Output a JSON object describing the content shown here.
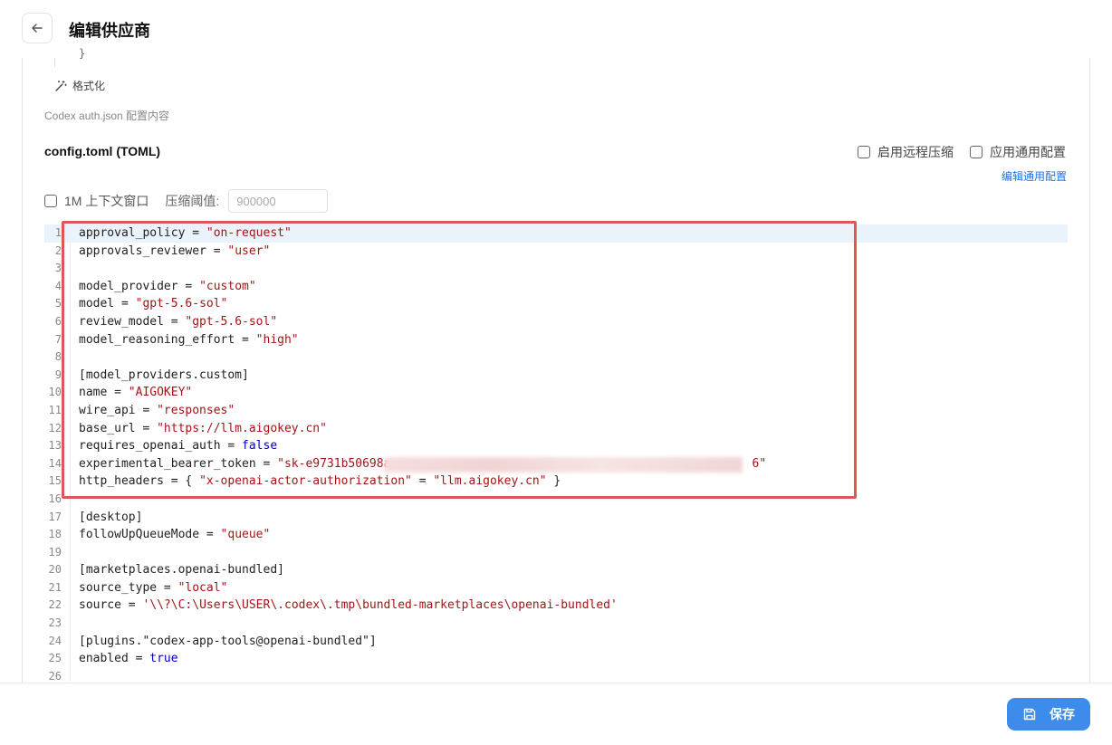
{
  "header": {
    "title": "编辑供应商"
  },
  "auth_section": {
    "json_tail": "}",
    "format_label": "格式化",
    "hint": "Codex auth.json 配置内容"
  },
  "config_section": {
    "title": "config.toml (TOML)",
    "remote_compress_label": "启用远程压缩",
    "apply_common_label": "应用通用配置",
    "edit_common_link": "编辑通用配置",
    "context_window_label": "1M 上下文窗口",
    "threshold_label": "压缩阈值:",
    "threshold_placeholder": "900000"
  },
  "editor": {
    "lines": [
      {
        "n": "1",
        "t": [
          {
            "c": "approval_policy = "
          },
          {
            "s": "\"on-request\""
          }
        ]
      },
      {
        "n": "2",
        "t": [
          {
            "c": "approvals_reviewer = "
          },
          {
            "s": "\"user\""
          }
        ]
      },
      {
        "n": "3",
        "t": []
      },
      {
        "n": "4",
        "t": [
          {
            "c": "model_provider = "
          },
          {
            "s": "\"custom\""
          }
        ]
      },
      {
        "n": "5",
        "t": [
          {
            "c": "model = "
          },
          {
            "s": "\"gpt-5.6-sol\""
          }
        ]
      },
      {
        "n": "6",
        "t": [
          {
            "c": "review_model = "
          },
          {
            "s": "\"gpt-5.6-sol\""
          }
        ]
      },
      {
        "n": "7",
        "t": [
          {
            "c": "model_reasoning_effort = "
          },
          {
            "s": "\"high\""
          }
        ]
      },
      {
        "n": "8",
        "t": []
      },
      {
        "n": "9",
        "t": [
          {
            "c": "[model_providers.custom]"
          }
        ]
      },
      {
        "n": "10",
        "t": [
          {
            "c": "name = "
          },
          {
            "s": "\"AIGOKEY\""
          }
        ]
      },
      {
        "n": "11",
        "t": [
          {
            "c": "wire_api = "
          },
          {
            "s": "\"responses\""
          }
        ]
      },
      {
        "n": "12",
        "t": [
          {
            "c": "base_url = "
          },
          {
            "s": "\"https://llm.aigokey.cn\""
          }
        ]
      },
      {
        "n": "13",
        "t": [
          {
            "c": "requires_openai_auth = "
          },
          {
            "k": "false"
          }
        ]
      },
      {
        "n": "14",
        "t": [
          {
            "c": "experimental_bearer_token = "
          },
          {
            "s": "\"sk-e9731b50698a                                                   6\""
          }
        ]
      },
      {
        "n": "15",
        "t": [
          {
            "c": "http_headers = { "
          },
          {
            "s": "\"x-openai-actor-authorization\""
          },
          {
            "c": " = "
          },
          {
            "s": "\"llm.aigokey.cn\""
          },
          {
            "c": " }"
          }
        ]
      },
      {
        "n": "16",
        "t": []
      },
      {
        "n": "17",
        "t": [
          {
            "c": "[desktop]"
          }
        ]
      },
      {
        "n": "18",
        "t": [
          {
            "c": "followUpQueueMode = "
          },
          {
            "s": "\"queue\""
          }
        ]
      },
      {
        "n": "19",
        "t": []
      },
      {
        "n": "20",
        "t": [
          {
            "c": "[marketplaces.openai-bundled]"
          }
        ]
      },
      {
        "n": "21",
        "t": [
          {
            "c": "source_type = "
          },
          {
            "s": "\"local\""
          }
        ]
      },
      {
        "n": "22",
        "t": [
          {
            "c": "source = "
          },
          {
            "s": "'\\\\?\\C:\\Users\\USER\\.codex\\.tmp\\bundled-marketplaces\\openai-bundled'"
          }
        ]
      },
      {
        "n": "23",
        "t": []
      },
      {
        "n": "24",
        "t": [
          {
            "c": "[plugins.\"codex-app-tools@openai-bundled\"]"
          }
        ]
      },
      {
        "n": "25",
        "t": [
          {
            "c": "enabled = "
          },
          {
            "k": "true"
          }
        ]
      },
      {
        "n": "26",
        "t": []
      }
    ]
  },
  "footer": {
    "save_label": "保存"
  },
  "colors": {
    "accent": "#3d8bea",
    "highlight_border": "#e05555",
    "string": "#a31515",
    "keyword": "#0000c0"
  }
}
